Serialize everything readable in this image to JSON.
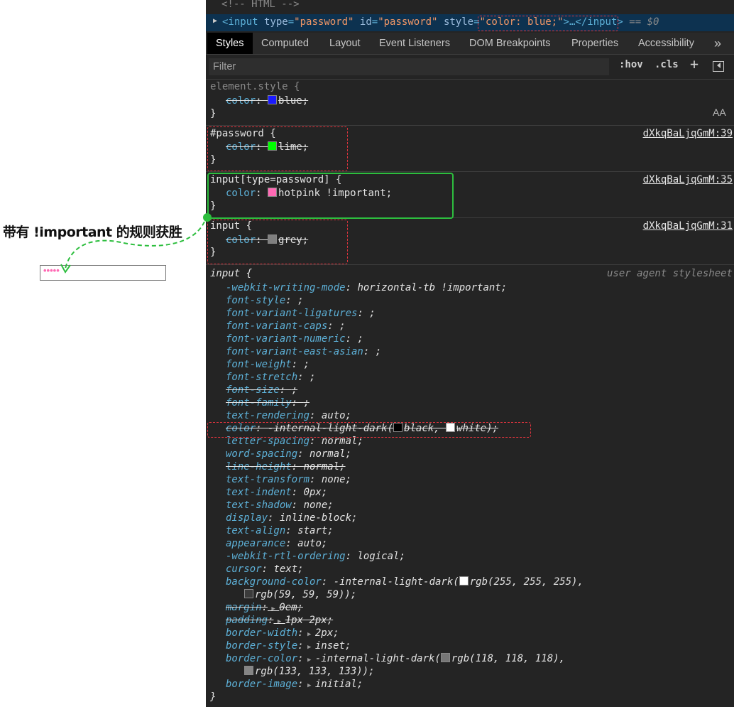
{
  "left": {
    "caption": "带有 !important 的规则获胜",
    "password_dots": "•••••"
  },
  "devtools": {
    "html_comment": "<!-- HTML -->",
    "selected_element": {
      "open": "<input",
      "attr1_name": "type",
      "attr1_value": "\"password\"",
      "attr2_name": "id",
      "attr2_value": "\"password\"",
      "attr3_name": "style",
      "attr3_value": "\"color: blue;\"",
      "close": ">…</input>",
      "suffix": "== $0"
    },
    "tabs": [
      "Styles",
      "Computed",
      "Layout",
      "Event Listeners",
      "DOM Breakpoints",
      "Properties",
      "Accessibility",
      "»"
    ],
    "filter": {
      "placeholder": "Filter",
      "hov": ":hov",
      "cls": ".cls",
      "plus": "+"
    },
    "rules": {
      "element_style": {
        "selector": "element.style {",
        "prop": "color",
        "value": "blue;",
        "close": "}",
        "aa": "AA"
      },
      "id_rule": {
        "selector": "#password {",
        "prop": "color",
        "value": "lime;",
        "close": "}",
        "source": "dXkqBaLjqGmM:39"
      },
      "attr_rule": {
        "selector": "input[type=password] {",
        "prop": "color",
        "value": "hotpink !important;",
        "close": "}",
        "source": "dXkqBaLjqGmM:35"
      },
      "type_rule": {
        "selector": "input {",
        "prop": "color",
        "value": "grey;",
        "close": "}",
        "source": "dXkqBaLjqGmM:31"
      },
      "ua_rule": {
        "selector": "input {",
        "source": "user agent stylesheet",
        "close": "}",
        "lines": [
          {
            "p": "-webkit-writing-mode",
            "v": "horizontal-tb !important;"
          },
          {
            "p": "font-style",
            "v": ";"
          },
          {
            "p": "font-variant-ligatures",
            "v": ";"
          },
          {
            "p": "font-variant-caps",
            "v": ";"
          },
          {
            "p": "font-variant-numeric",
            "v": ";"
          },
          {
            "p": "font-variant-east-asian",
            "v": ";"
          },
          {
            "p": "font-weight",
            "v": ";"
          },
          {
            "p": "font-stretch",
            "v": ";"
          },
          {
            "p": "font-size",
            "v": ";"
          },
          {
            "p": "font-family",
            "v": ";"
          },
          {
            "p": "text-rendering",
            "v": "auto;"
          },
          {
            "p": "color",
            "v1": "-internal-light-dark(",
            "v2": "black, ",
            "v3": "white);"
          },
          {
            "p": "letter-spacing",
            "v": "normal;"
          },
          {
            "p": "word-spacing",
            "v": "normal;"
          },
          {
            "p": "line-height",
            "v": "normal;"
          },
          {
            "p": "text-transform",
            "v": "none;"
          },
          {
            "p": "text-indent",
            "v": "0px;"
          },
          {
            "p": "text-shadow",
            "v": "none;"
          },
          {
            "p": "display",
            "v": "inline-block;"
          },
          {
            "p": "text-align",
            "v": "start;"
          },
          {
            "p": "appearance",
            "v": "auto;"
          },
          {
            "p": "-webkit-rtl-ordering",
            "v": "logical;"
          },
          {
            "p": "cursor",
            "v": "text;"
          },
          {
            "p": "background-color",
            "v1": "-internal-light-dark(",
            "v2": "rgb(255, 255, 255),",
            "v3": "rgb(59, 59, 59));"
          },
          {
            "p": "margin",
            "v": "0em;"
          },
          {
            "p": "padding",
            "v": "1px 2px;"
          },
          {
            "p": "border-width",
            "v": "2px;"
          },
          {
            "p": "border-style",
            "v": "inset;"
          },
          {
            "p": "border-color",
            "v1": "-internal-light-dark(",
            "v2": "rgb(118, 118, 118),",
            "v3": "rgb(133, 133, 133));"
          },
          {
            "p": "border-image",
            "v": "initial;"
          }
        ]
      }
    }
  },
  "colors": {
    "blue": "#1a1aff",
    "lime": "#00ff00",
    "hotpink": "#ff69b4",
    "grey": "#808080",
    "black": "#000000",
    "white": "#ffffff",
    "rgb255": "#ffffff",
    "rgb59": "#3b3b3b",
    "rgb118": "#767676",
    "rgb133": "#858585",
    "highlight_red": "#e0343e",
    "highlight_green": "#2dbe3e"
  }
}
